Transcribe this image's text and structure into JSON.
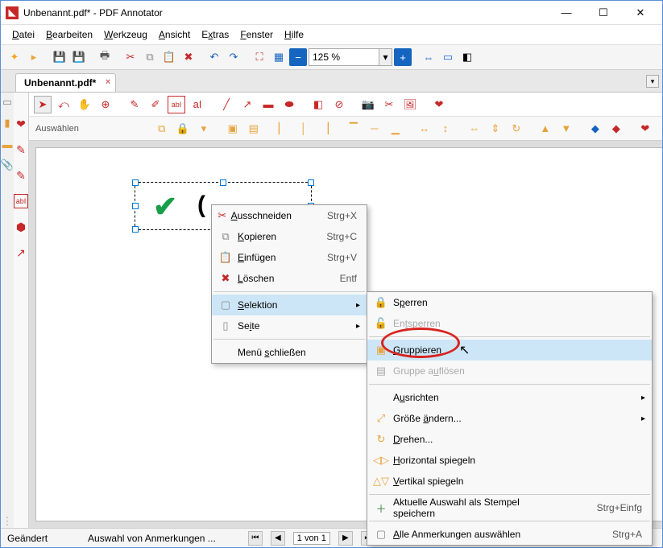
{
  "titlebar": {
    "title": "Unbenannt.pdf* - PDF Annotator"
  },
  "menu": {
    "datei": "Datei",
    "bearbeiten": "Bearbeiten",
    "werkzeug": "Werkzeug",
    "ansicht": "Ansicht",
    "extras": "Extras",
    "fenster": "Fenster",
    "hilfe": "Hilfe"
  },
  "tab": {
    "label": "Unbenannt.pdf*"
  },
  "zoom": {
    "value": "125 %"
  },
  "select_label": "Auswählen",
  "context1": {
    "cut": {
      "label": "Ausschneiden",
      "short": "Strg+X"
    },
    "copy": {
      "label": "Kopieren",
      "short": "Strg+C"
    },
    "paste": {
      "label": "Einfügen",
      "short": "Strg+V"
    },
    "delete": {
      "label": "Löschen",
      "short": "Entf"
    },
    "selection": {
      "label": "Selektion"
    },
    "page": {
      "label": "Seite"
    },
    "close": {
      "label": "Menü schließen"
    }
  },
  "context2": {
    "lock": {
      "label": "Sperren"
    },
    "unlock": {
      "label": "Entsperren"
    },
    "group": {
      "label": "Gruppieren"
    },
    "ungroup": {
      "label": "Gruppe auflösen"
    },
    "align": {
      "label": "Ausrichten"
    },
    "resize": {
      "label": "Größe ändern..."
    },
    "rotate": {
      "label": "Drehen..."
    },
    "fliph": {
      "label": "Horizontal spiegeln"
    },
    "flipv": {
      "label": "Vertikal spiegeln"
    },
    "stamp": {
      "label": "Aktuelle Auswahl als Stempel speichern",
      "short": "Strg+Einfg"
    },
    "selectall": {
      "label": "Alle Anmerkungen auswählen",
      "short": "Strg+A"
    }
  },
  "status": {
    "changed": "Geändert",
    "hint": "Auswahl von Anmerkungen ...",
    "page": "1 von 1"
  }
}
